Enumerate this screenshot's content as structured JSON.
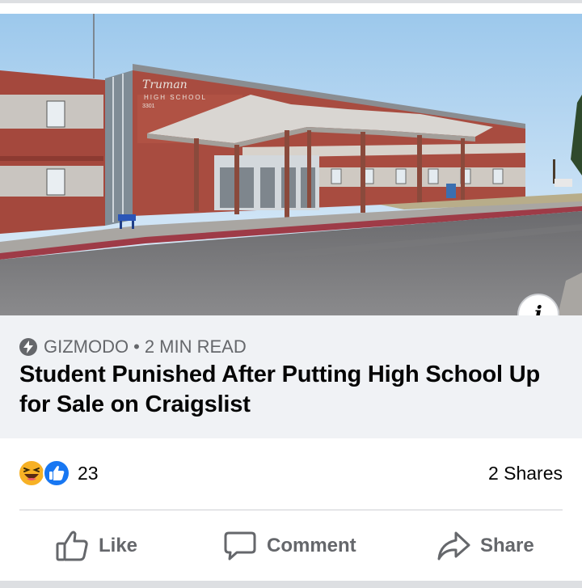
{
  "article": {
    "source": "GIZMODO",
    "separator": "•",
    "read_time": "2 MIN READ",
    "headline": "Student Punished After Putting High School Up for Sale on Craigslist",
    "image_sign": {
      "school_name": "Truman",
      "school_line2": "HIGH SCHOOL",
      "address_number": "3301"
    }
  },
  "engagement": {
    "reactions": [
      "haha-icon",
      "like-icon"
    ],
    "reaction_count": "23",
    "shares": "2 Shares"
  },
  "actions": {
    "like_label": "Like",
    "comment_label": "Comment",
    "share_label": "Share"
  },
  "colors": {
    "meta_background": "#f0f2f5",
    "secondary_text": "#65676b",
    "like_blue": "#1877f2",
    "haha_yellow": "#f7b125"
  }
}
